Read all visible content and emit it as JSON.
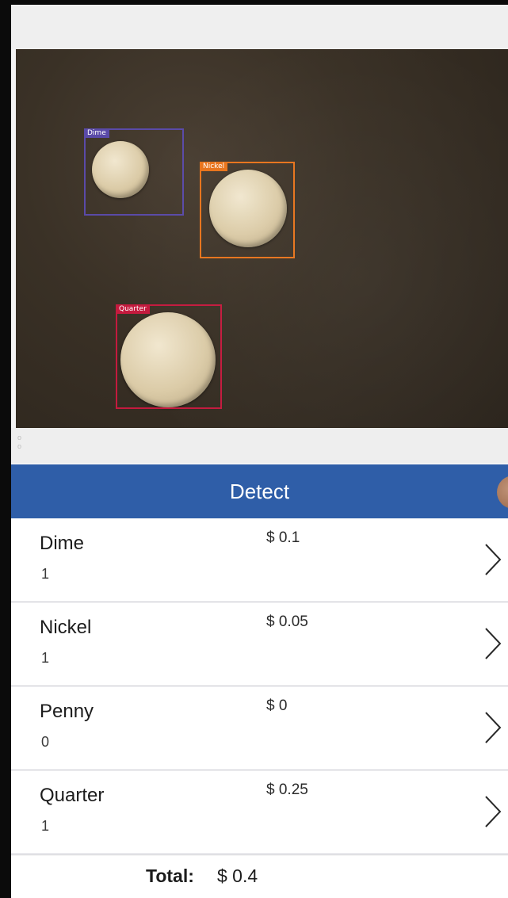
{
  "camera": {
    "detections": [
      {
        "label": "Dime",
        "color": "#5a4aa8"
      },
      {
        "label": "Nickel",
        "color": "#e8741c"
      },
      {
        "label": "Quarter",
        "color": "#c41a3e"
      }
    ]
  },
  "detect_button": {
    "label": "Detect",
    "color": "#2f5ea8"
  },
  "coins": [
    {
      "name": "Dime",
      "count": "1",
      "value": "$ 0.1"
    },
    {
      "name": "Nickel",
      "count": "1",
      "value": "$ 0.05"
    },
    {
      "name": "Penny",
      "count": "0",
      "value": "$ 0"
    },
    {
      "name": "Quarter",
      "count": "1",
      "value": "$ 0.25"
    }
  ],
  "total": {
    "label": "Total:",
    "value": "$ 0.4"
  }
}
